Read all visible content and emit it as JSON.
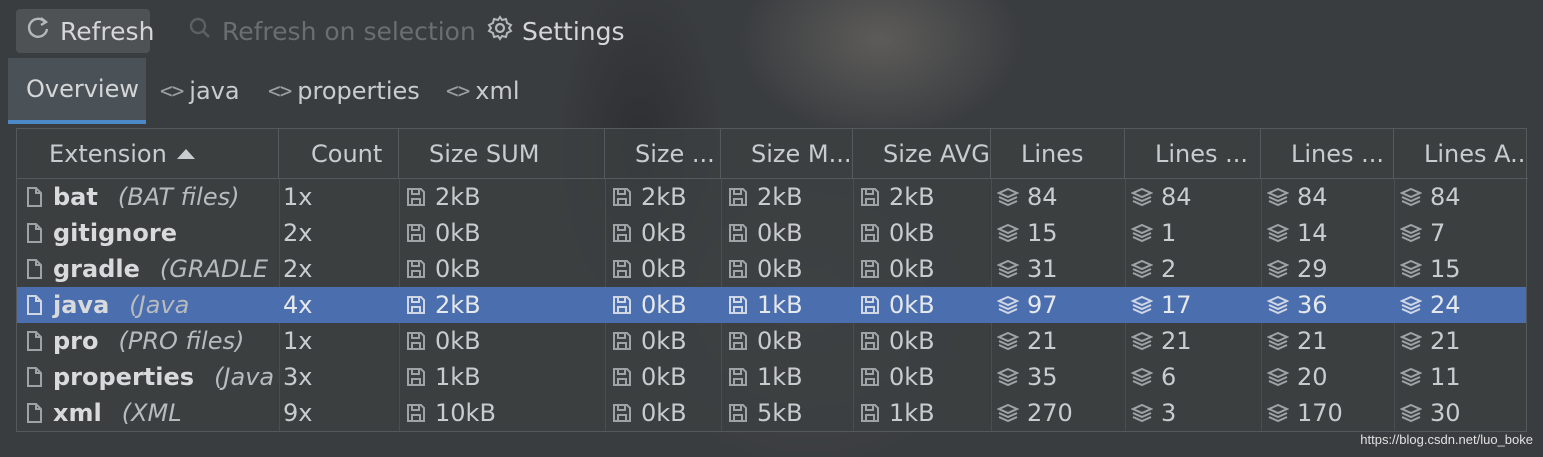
{
  "toolbar": {
    "refresh_label": "Refresh",
    "refresh_selection_label": "Refresh on selection",
    "settings_label": "Settings"
  },
  "tabs": [
    {
      "label": "Overview",
      "active": true
    },
    {
      "label": "java",
      "icon": "code-icon"
    },
    {
      "label": "properties",
      "icon": "code-icon"
    },
    {
      "label": "xml",
      "icon": "code-icon"
    }
  ],
  "table": {
    "columns": [
      "Extension",
      "Count",
      "Size SUM",
      "Size ...",
      "Size M...",
      "Size AVG",
      "Lines",
      "Lines ...",
      "Lines ...",
      "Lines A..."
    ],
    "sorted_column": "Extension",
    "rows": [
      {
        "name": "bat",
        "desc": "(BAT files)",
        "count": "1x",
        "size_sum": "2kB",
        "size_min": "2kB",
        "size_max": "2kB",
        "size_avg": "2kB",
        "lines": "84",
        "lines_min": "84",
        "lines_max": "84",
        "lines_avg": "84"
      },
      {
        "name": "gitignore",
        "desc": "",
        "count": "2x",
        "size_sum": "0kB",
        "size_min": "0kB",
        "size_max": "0kB",
        "size_avg": "0kB",
        "lines": "15",
        "lines_min": "1",
        "lines_max": "14",
        "lines_avg": "7"
      },
      {
        "name": "gradle",
        "desc": "(GRADLE",
        "count": "2x",
        "size_sum": "0kB",
        "size_min": "0kB",
        "size_max": "0kB",
        "size_avg": "0kB",
        "lines": "31",
        "lines_min": "2",
        "lines_max": "29",
        "lines_avg": "15"
      },
      {
        "name": "java",
        "desc": "(Java",
        "count": "4x",
        "size_sum": "2kB",
        "size_min": "0kB",
        "size_max": "1kB",
        "size_avg": "0kB",
        "lines": "97",
        "lines_min": "17",
        "lines_max": "36",
        "lines_avg": "24",
        "selected": true
      },
      {
        "name": "pro",
        "desc": "(PRO files)",
        "count": "1x",
        "size_sum": "0kB",
        "size_min": "0kB",
        "size_max": "0kB",
        "size_avg": "0kB",
        "lines": "21",
        "lines_min": "21",
        "lines_max": "21",
        "lines_avg": "21"
      },
      {
        "name": "properties",
        "desc": "(Java",
        "count": "3x",
        "size_sum": "1kB",
        "size_min": "0kB",
        "size_max": "1kB",
        "size_avg": "0kB",
        "lines": "35",
        "lines_min": "6",
        "lines_max": "20",
        "lines_avg": "11"
      },
      {
        "name": "xml",
        "desc": "(XML",
        "count": "9x",
        "size_sum": "10kB",
        "size_min": "0kB",
        "size_max": "5kB",
        "size_avg": "1kB",
        "lines": "270",
        "lines_min": "3",
        "lines_max": "170",
        "lines_avg": "30"
      }
    ]
  },
  "watermark": "https://blog.csdn.net/luo_boke",
  "colors": {
    "background": "#3a3d40",
    "selection": "#4b6eaf",
    "tab_underline": "#4a88c7"
  }
}
